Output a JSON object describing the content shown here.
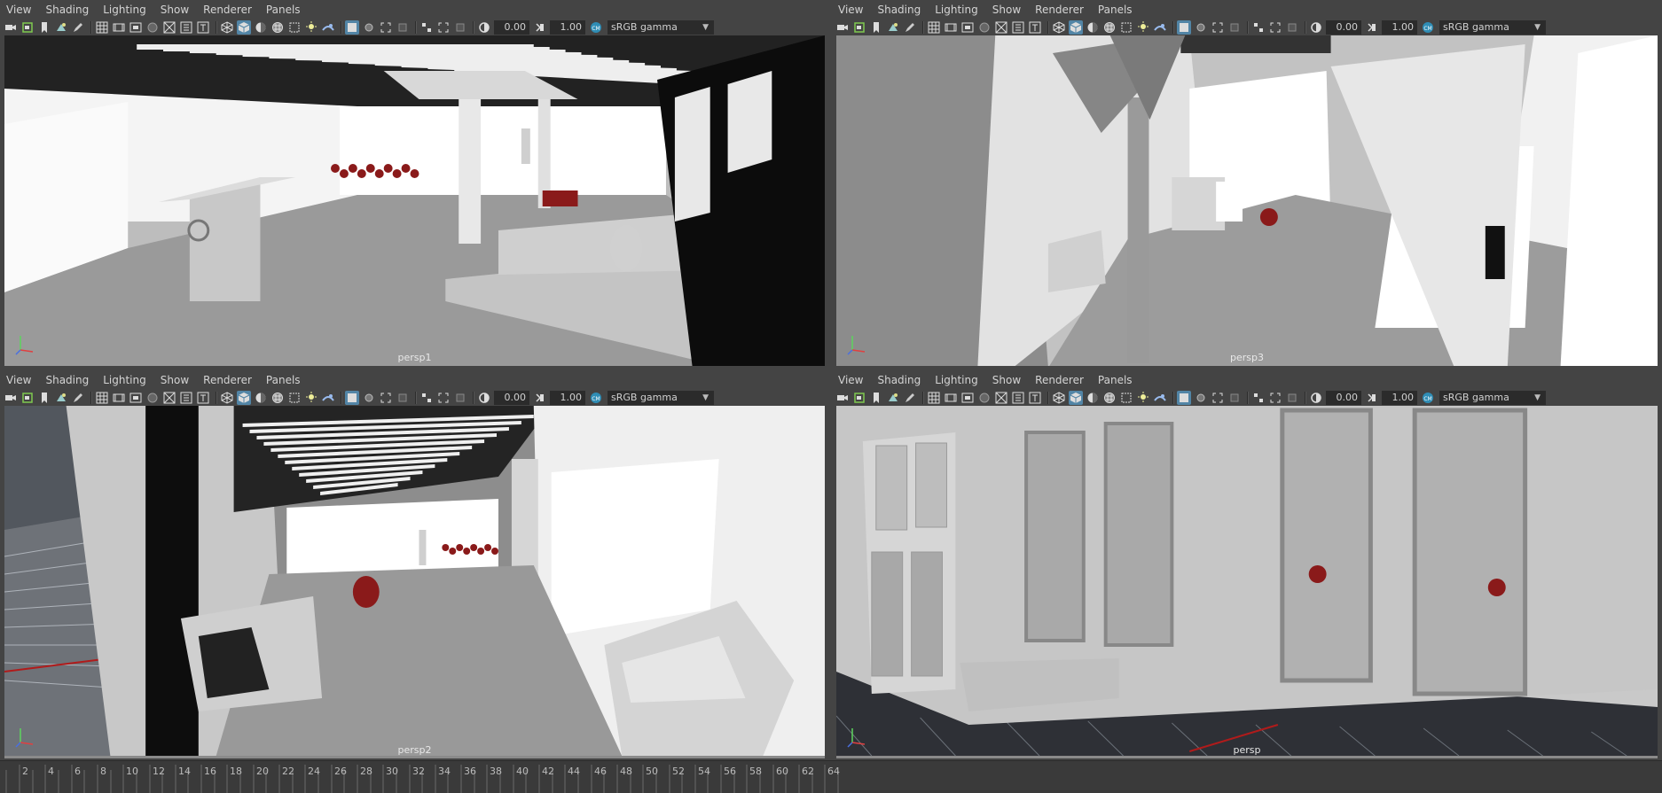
{
  "menu": [
    "View",
    "Shading",
    "Lighting",
    "Show",
    "Renderer",
    "Panels"
  ],
  "toolbar": {
    "exposure": "0.00",
    "gamma": "1.00",
    "color_space": "sRGB gamma"
  },
  "panels": [
    {
      "camera": "persp1"
    },
    {
      "camera": "persp3"
    },
    {
      "camera": "persp2"
    },
    {
      "camera": "persp"
    }
  ],
  "timeline": {
    "frames": [
      "2",
      "4",
      "6",
      "8",
      "10",
      "12",
      "14",
      "16",
      "18",
      "20",
      "22",
      "24",
      "26",
      "28",
      "30",
      "32",
      "34",
      "36",
      "38",
      "40",
      "42",
      "44",
      "46",
      "48",
      "50",
      "52",
      "54",
      "56",
      "58",
      "60",
      "62",
      "64"
    ]
  },
  "icons": [
    "camera-select-icon",
    "camera-attr-icon",
    "bookmark-icon",
    "image-plane-icon",
    "grid-icon",
    "film-gate-icon",
    "resolution-gate-icon",
    "safe-action-icon",
    "wireframe-icon",
    "smooth-shade-icon",
    "textured-icon",
    "lights-icon",
    "shadows-icon",
    "ambient-occlusion-icon",
    "isolate-select-icon",
    "xray-icon",
    "exposure-icon",
    "gamma-icon",
    "color-management-icon"
  ]
}
